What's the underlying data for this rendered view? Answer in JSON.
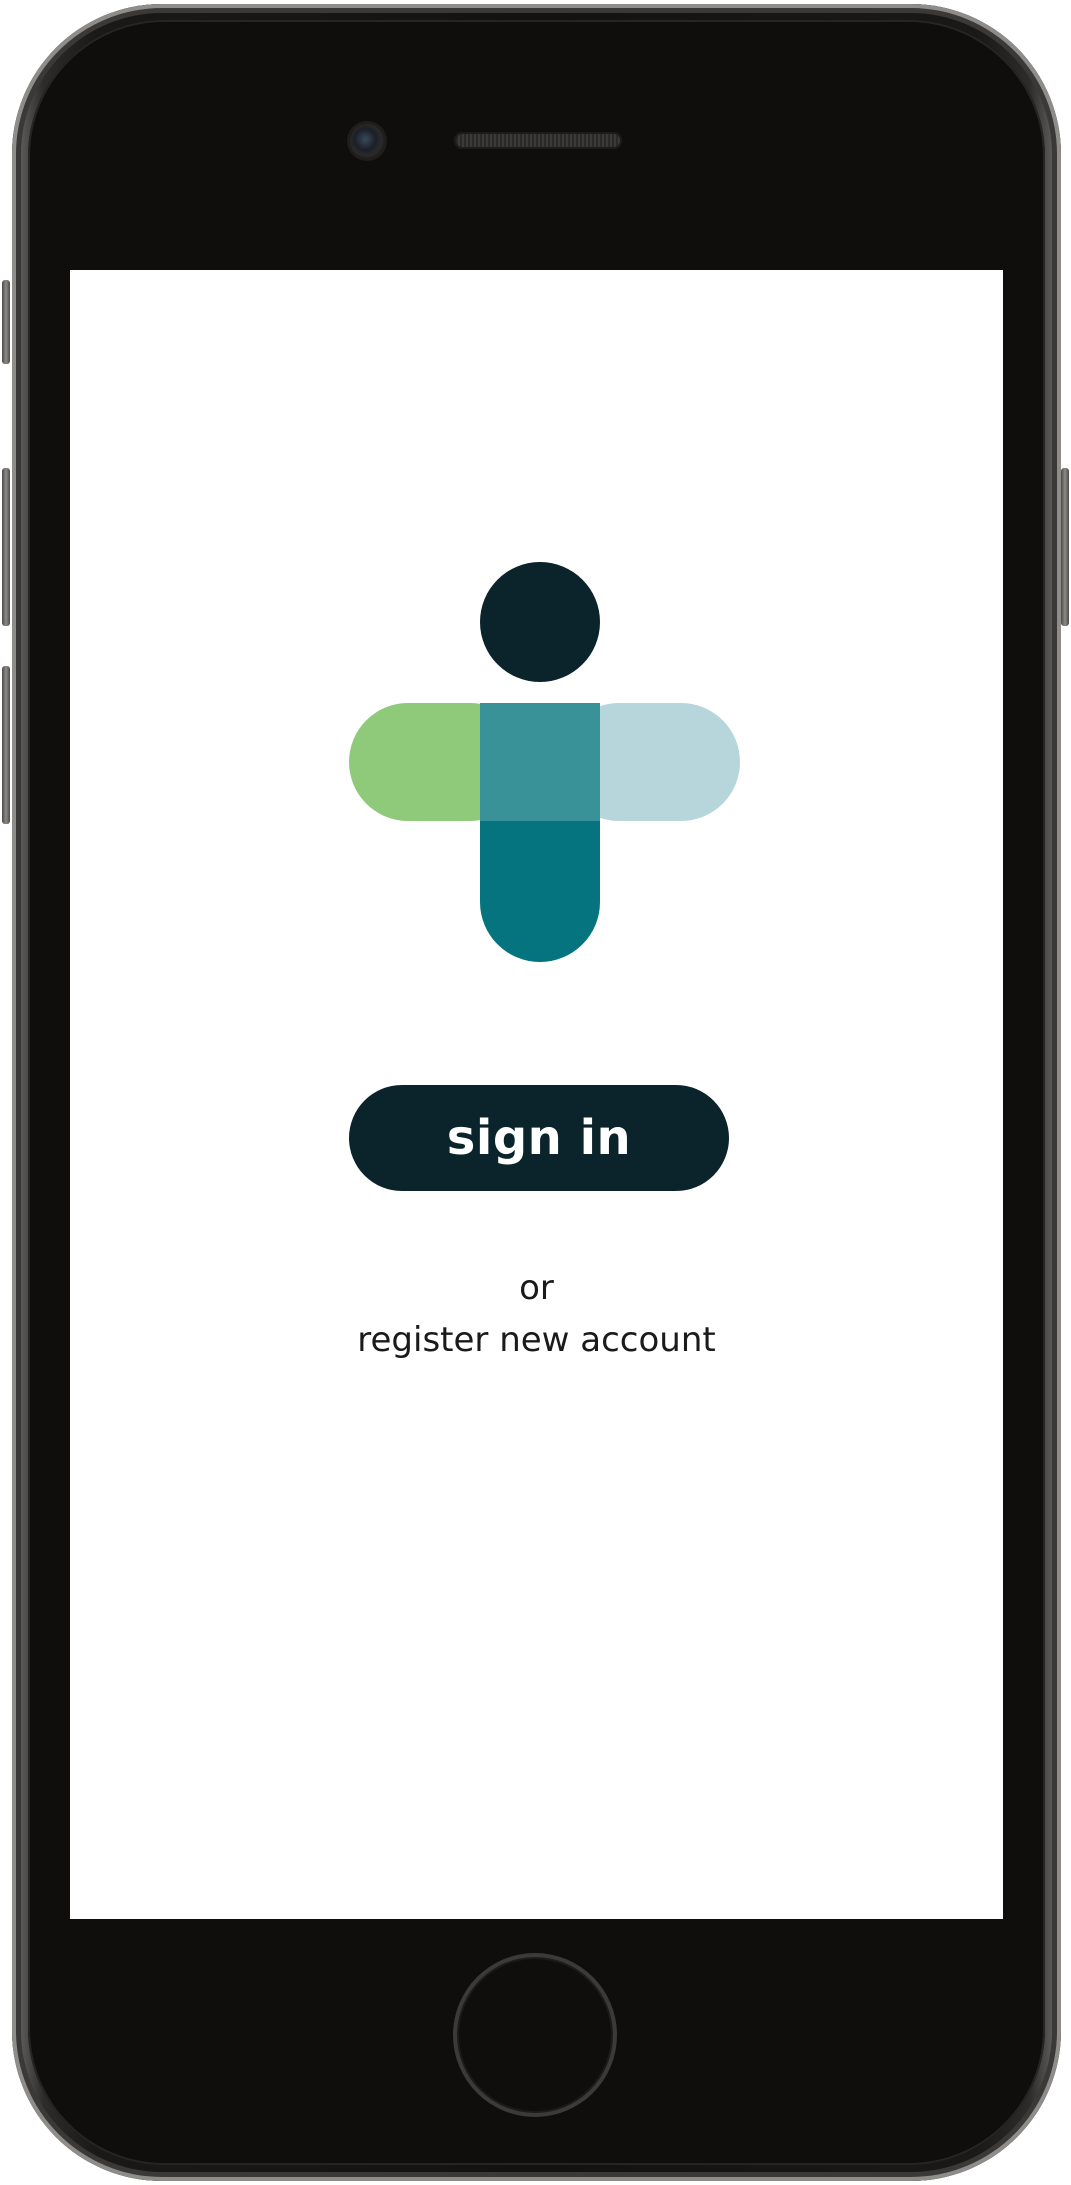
{
  "app": {
    "colors": {
      "dark": "#0b242b",
      "green": "#8fc97a",
      "teal_mid": "#3a9299",
      "light_blue": "#b6d6db",
      "teal_dark": "#05747f",
      "screen_bg": "#ffffff"
    }
  },
  "logo": {
    "icon": "medical-cross-person-logo"
  },
  "auth": {
    "signin_label": "sign in",
    "or_text": "or",
    "register_label": "register new account"
  }
}
